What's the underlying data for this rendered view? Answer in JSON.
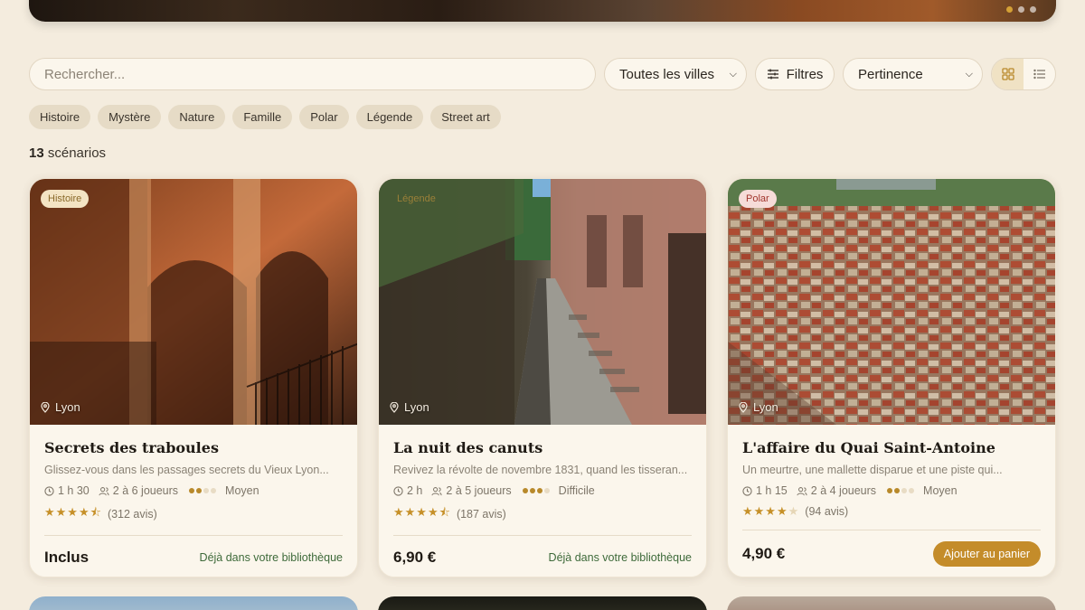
{
  "search": {
    "placeholder": "Rechercher..."
  },
  "filters": {
    "city": "Toutes les villes",
    "filters_label": "Filtres",
    "sort": "Pertinence"
  },
  "tags": [
    "Histoire",
    "Mystère",
    "Nature",
    "Famille",
    "Polar",
    "Légende",
    "Street art"
  ],
  "results": {
    "count": "13",
    "label": " scénarios"
  },
  "cards": [
    {
      "badge": "Histoire",
      "location": "Lyon",
      "title": "Secrets des traboules",
      "description": "Glissez-vous dans les passages secrets du Vieux Lyon...",
      "duration": "1 h 30",
      "players": "2 à 6 joueurs",
      "difficulty": "Moyen",
      "difficulty_level": 2,
      "rating": 4.5,
      "reviews": "(312 avis)",
      "price": "Inclus",
      "action": "Déjà dans votre bibliothèque"
    },
    {
      "badge": "Légende",
      "location": "Lyon",
      "title": "La nuit des canuts",
      "description": "Revivez la révolte de novembre 1831, quand les tisseran...",
      "duration": "2 h",
      "players": "2 à 5 joueurs",
      "difficulty": "Difficile",
      "difficulty_level": 3,
      "rating": 4.5,
      "reviews": "(187 avis)",
      "price": "6,90 €",
      "action": "Déjà dans votre bibliothèque"
    },
    {
      "badge": "Polar",
      "location": "Lyon",
      "title": "L'affaire du Quai Saint-Antoine",
      "description": "Un meurtre, une mallette disparue et une piste qui...",
      "duration": "1 h 15",
      "players": "2 à 4 joueurs",
      "difficulty": "Moyen",
      "difficulty_level": 2,
      "rating": 4,
      "reviews": "(94 avis)",
      "price": "4,90 €",
      "action": "Ajouter au panier"
    }
  ]
}
